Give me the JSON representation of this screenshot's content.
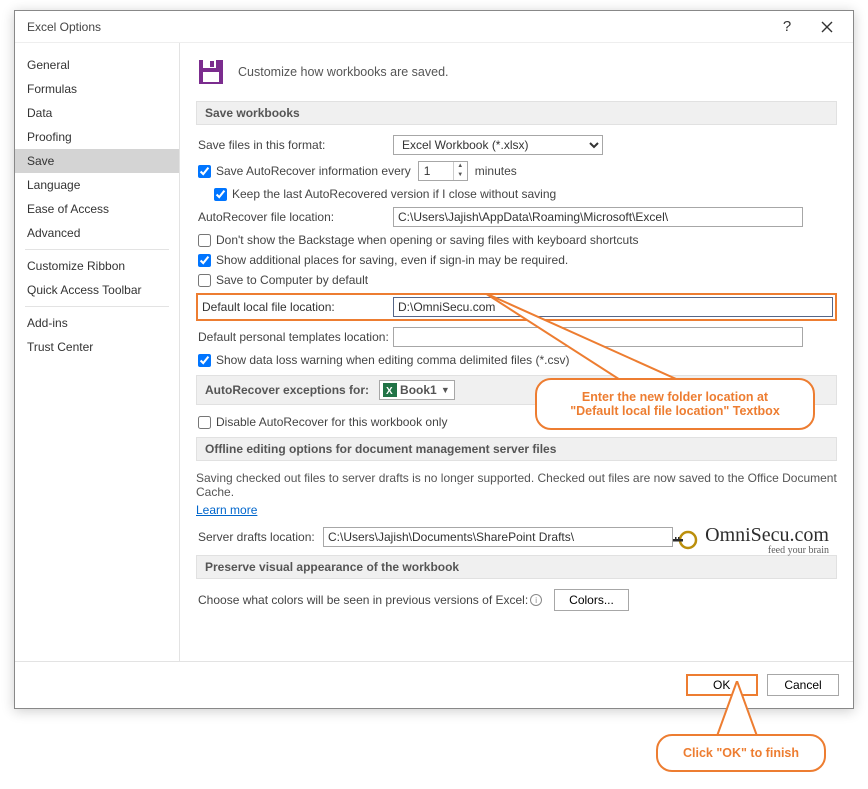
{
  "window": {
    "title": "Excel Options"
  },
  "sidebar": {
    "items": [
      {
        "label": "General"
      },
      {
        "label": "Formulas"
      },
      {
        "label": "Data"
      },
      {
        "label": "Proofing"
      },
      {
        "label": "Save",
        "active": true
      },
      {
        "label": "Language"
      },
      {
        "label": "Ease of Access"
      },
      {
        "label": "Advanced"
      }
    ],
    "items2": [
      {
        "label": "Customize Ribbon"
      },
      {
        "label": "Quick Access Toolbar"
      }
    ],
    "items3": [
      {
        "label": "Add-ins"
      },
      {
        "label": "Trust Center"
      }
    ]
  },
  "header": {
    "title": "Customize how workbooks are saved."
  },
  "sec1": {
    "title": "Save workbooks",
    "save_format_label": "Save files in this format:",
    "save_format_value": "Excel Workbook (*.xlsx)",
    "autorecover_every": "Save AutoRecover information every",
    "autorecover_minutes": "1",
    "minutes": "minutes",
    "keep_last": "Keep the last AutoRecovered version if I close without saving",
    "autorecover_loc_label": "AutoRecover file location:",
    "autorecover_loc_value": "C:\\Users\\Jajish\\AppData\\Roaming\\Microsoft\\Excel\\",
    "dont_show_backstage": "Don't show the Backstage when opening or saving files with keyboard shortcuts",
    "show_additional": "Show additional places for saving, even if sign-in may be required.",
    "save_to_computer": "Save to Computer by default",
    "default_local_label": "Default local file location:",
    "default_local_value": "D:\\OmniSecu.com",
    "default_templates_label": "Default personal templates location:",
    "default_templates_value": "",
    "data_loss": "Show data loss warning when editing comma delimited files (*.csv)"
  },
  "sec2": {
    "title_left": "AutoRecover exceptions for:",
    "book": "Book1",
    "disable": "Disable AutoRecover for this workbook only"
  },
  "sec3": {
    "title": "Offline editing options for document management server files",
    "note": "Saving checked out files to server drafts is no longer supported. Checked out files are now saved to the Office Document Cache.",
    "learn": "Learn more",
    "drafts_label": "Server drafts location:",
    "drafts_value": "C:\\Users\\Jajish\\Documents\\SharePoint Drafts\\"
  },
  "sec4": {
    "title": "Preserve visual appearance of the workbook",
    "choose": "Choose what colors will be seen in previous versions of Excel:",
    "colors_btn": "Colors..."
  },
  "footer": {
    "ok": "OK",
    "cancel": "Cancel"
  },
  "callout1": {
    "line1": "Enter the new folder location at",
    "line2": "\"Default local file location\" Textbox"
  },
  "callout2": {
    "text": "Click \"OK\" to finish"
  },
  "watermark": {
    "main": "OmniSecu.com",
    "sub": "feed your brain"
  }
}
